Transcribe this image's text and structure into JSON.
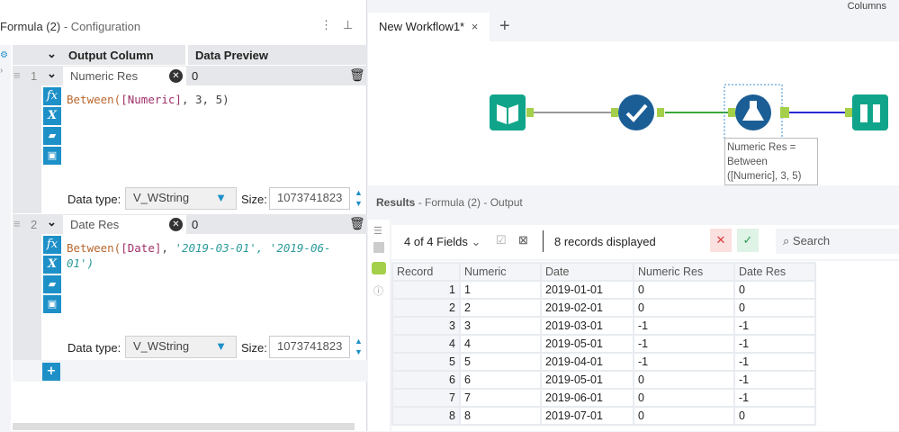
{
  "top_right_label": "Columns",
  "config": {
    "title": "Formula (2)",
    "subtitle": "- Configuration",
    "col_output": "Output Column",
    "col_preview": "Data Preview",
    "rows": [
      {
        "num": "1",
        "name": "Numeric Res",
        "preview": "0",
        "expr_fn": "Between(",
        "expr_field": "[Numeric]",
        "expr_rest": ", 3, 5)",
        "expr_str1": "",
        "expr_str2": "",
        "data_type_label": "Data type:",
        "data_type": "V_WString",
        "size_label": "Size:",
        "size": "1073741823"
      },
      {
        "num": "2",
        "name": "Date Res",
        "preview": "0",
        "expr_fn": "Between(",
        "expr_field": "[Date]",
        "expr_rest": ", ",
        "expr_str1": "'2019-03-01'",
        "expr_str2": ", '2019-06-01')",
        "data_type_label": "Data type:",
        "data_type": "V_WString",
        "size_label": "Size:",
        "size": "1073741823"
      }
    ],
    "add_label": "+"
  },
  "tabs": {
    "active": "New Workflow1*",
    "close": "×",
    "add": "+"
  },
  "canvas": {
    "annotation": "Numeric Res = Between ([Numeric], 3, 5)",
    "colors": {
      "teal": "#10a58a",
      "navy": "#1b5e96",
      "anchor": "#a4cf4a"
    }
  },
  "results": {
    "title": "Results",
    "subtitle": "- Formula (2) - Output",
    "fields": "4 of 4 Fields",
    "records": "8 records displayed",
    "search_placeholder": "Search",
    "columns": [
      "Record",
      "Numeric",
      "Date",
      "Numeric Res",
      "Date Res"
    ],
    "rows": [
      [
        "1",
        "1",
        "2019-01-01",
        "0",
        "0"
      ],
      [
        "2",
        "2",
        "2019-02-01",
        "0",
        "0"
      ],
      [
        "3",
        "3",
        "2019-03-01",
        "-1",
        "-1"
      ],
      [
        "4",
        "4",
        "2019-05-01",
        "-1",
        "-1"
      ],
      [
        "5",
        "5",
        "2019-04-01",
        "-1",
        "-1"
      ],
      [
        "6",
        "6",
        "2019-05-01",
        "0",
        "-1"
      ],
      [
        "7",
        "7",
        "2019-06-01",
        "0",
        "-1"
      ],
      [
        "8",
        "8",
        "2019-07-01",
        "0",
        "0"
      ]
    ]
  }
}
